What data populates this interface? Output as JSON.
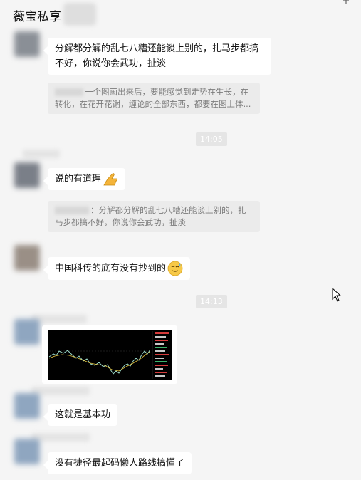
{
  "header": {
    "title": "薇宝私享",
    "pin_icon": "pin-icon"
  },
  "messages": [
    {
      "type": "text",
      "text": "分解都分解的乱七八糟还能谈上别的，扎马步都搞不好，你说你会武功，扯淡"
    },
    {
      "type": "quote",
      "text": "一个图画出来后，要能感觉到走势在生长，在转化，在花开花谢，缠论的全部东西，都要在图上体..."
    },
    {
      "type": "time",
      "text": "14:05"
    },
    {
      "type": "text",
      "text": "说的有道理",
      "emoji": "thumbs-up-icon"
    },
    {
      "type": "quote",
      "text": "：分解都分解的乱七八糟还能谈上别的，扎马步都搞不好，你说你会武功，扯淡"
    },
    {
      "type": "text",
      "text": "中国科传的底有没有抄到的",
      "emoji": "sweat-smile-icon"
    },
    {
      "type": "time",
      "text": "14:13"
    },
    {
      "type": "image",
      "content": "stock-chart-thumbnail"
    },
    {
      "type": "text",
      "text": "这就是基本功"
    },
    {
      "type": "text",
      "text": "没有捷径最起码懒人路线搞懂了"
    }
  ],
  "colors": {
    "background": "#f5f5f5",
    "bubble": "#ffffff",
    "quote": "#ebebeb",
    "time_badge": "#e5e5e5",
    "chart_bg": "#000000",
    "chart_line": "#9ad8c8",
    "chart_accent": "#e8c840"
  }
}
